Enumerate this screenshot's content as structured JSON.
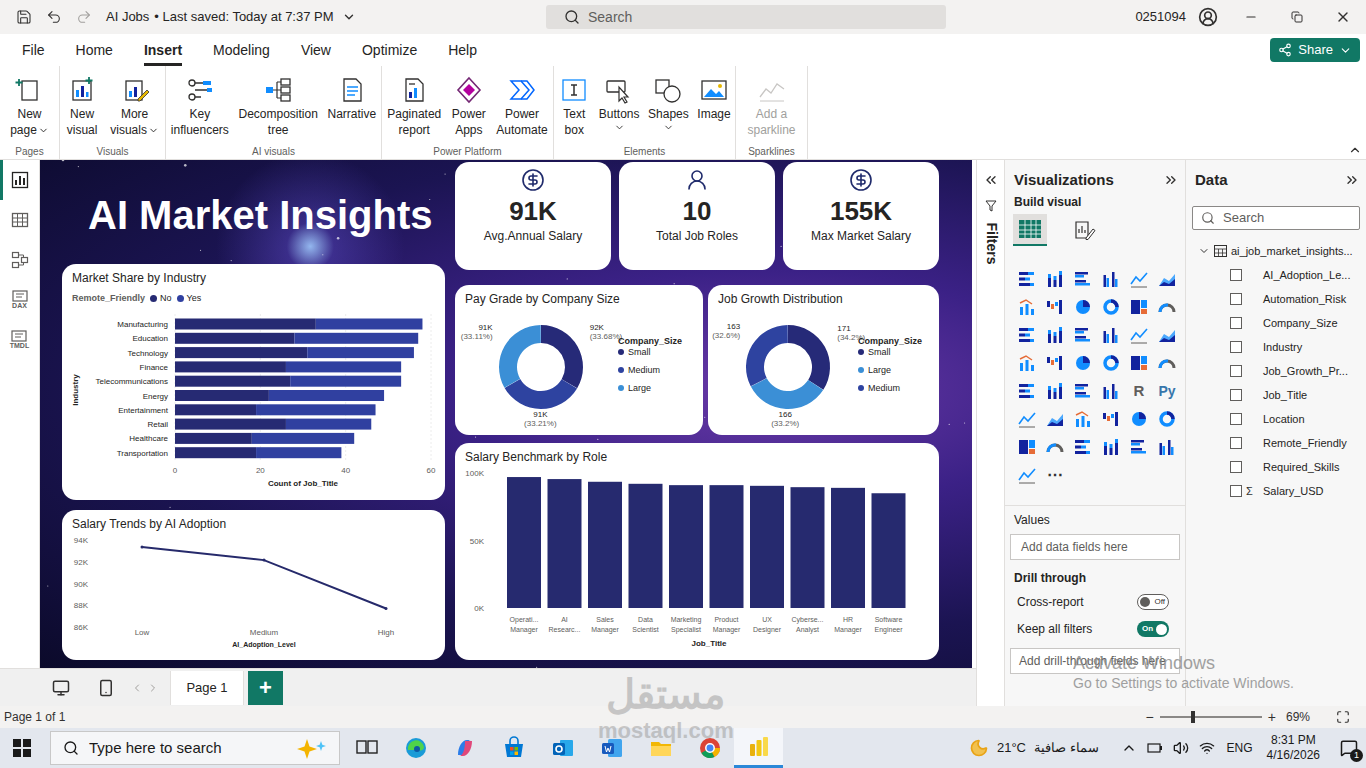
{
  "window": {
    "title": "AI Jobs",
    "saved": "• Last saved: Today at 7:37 PM",
    "search_placeholder": "Search",
    "user": "0251094"
  },
  "menu": [
    {
      "label": "File",
      "selected": false
    },
    {
      "label": "Home",
      "selected": false
    },
    {
      "label": "Insert",
      "selected": true
    },
    {
      "label": "Modeling",
      "selected": false
    },
    {
      "label": "View",
      "selected": false
    },
    {
      "label": "Optimize",
      "selected": false
    },
    {
      "label": "Help",
      "selected": false
    }
  ],
  "share": "Share",
  "ribbon": [
    {
      "group": "Pages",
      "items": [
        {
          "lines": [
            "New",
            "page"
          ],
          "dropdown": true,
          "disabled": false
        }
      ]
    },
    {
      "group": "Visuals",
      "items": [
        {
          "lines": [
            "New",
            "visual"
          ],
          "dropdown": false,
          "disabled": false
        },
        {
          "lines": [
            "More",
            "visuals"
          ],
          "dropdown": true,
          "disabled": false
        }
      ]
    },
    {
      "group": "AI visuals",
      "items": [
        {
          "lines": [
            "Key",
            "influencers"
          ],
          "dropdown": false,
          "disabled": false
        },
        {
          "lines": [
            "Decomposition",
            "tree"
          ],
          "dropdown": false,
          "disabled": false
        },
        {
          "lines": [
            "Narrative"
          ],
          "dropdown": false,
          "disabled": false
        }
      ]
    },
    {
      "group": "Power Platform",
      "items": [
        {
          "lines": [
            "Paginated",
            "report"
          ],
          "dropdown": false,
          "disabled": false
        },
        {
          "lines": [
            "Power",
            "Apps"
          ],
          "dropdown": false,
          "disabled": false
        },
        {
          "lines": [
            "Power",
            "Automate"
          ],
          "dropdown": false,
          "disabled": false
        }
      ]
    },
    {
      "group": "Elements",
      "items": [
        {
          "lines": [
            "Text",
            "box"
          ],
          "dropdown": false,
          "disabled": false
        },
        {
          "lines": [
            "Buttons"
          ],
          "dropdown": true,
          "disabled": false
        },
        {
          "lines": [
            "Shapes"
          ],
          "dropdown": true,
          "disabled": false
        },
        {
          "lines": [
            "Image"
          ],
          "dropdown": false,
          "disabled": false
        }
      ]
    },
    {
      "group": "Sparklines",
      "items": [
        {
          "lines": [
            "Add a",
            "sparkline"
          ],
          "dropdown": false,
          "disabled": true
        }
      ]
    }
  ],
  "rail": [
    {
      "kind": "report",
      "label": "",
      "selected": true
    },
    {
      "kind": "table",
      "label": "",
      "selected": false
    },
    {
      "kind": "model",
      "label": "",
      "selected": false
    },
    {
      "kind": "dax",
      "label": "DAX",
      "selected": false
    },
    {
      "kind": "tmdl",
      "label": "TMDL",
      "selected": false
    }
  ],
  "canvas": {
    "title": "AI Market Insights",
    "kpis": [
      {
        "value": "91K",
        "label": "Avg.Annual Salary"
      },
      {
        "value": "10",
        "label": "Total Job Roles"
      },
      {
        "value": "155K",
        "label": "Max Market Salary"
      }
    ],
    "market_share": {
      "title": "Market Share by Industry",
      "legend_title": "Remote_Friendly",
      "axis_title": "Industry",
      "x_title": "Count of Job_Title",
      "ticks": [
        "0",
        "20",
        "40",
        "60"
      ],
      "max": 60,
      "categories": [
        "Manufacturing",
        "Education",
        "Technology",
        "Finance",
        "Telecommunications",
        "Energy",
        "Entertainment",
        "Retail",
        "Healthcare",
        "Transportation"
      ],
      "series": [
        {
          "name": "No",
          "color": "#262a73",
          "values": [
            33,
            28,
            31,
            26,
            27,
            22,
            19,
            26,
            18,
            19
          ]
        },
        {
          "name": "Yes",
          "color": "#3040a0",
          "values": [
            25,
            29,
            25,
            27,
            26,
            27,
            28,
            20,
            24,
            20
          ]
        }
      ]
    },
    "salary_trend": {
      "title": "Salary Trends by AI Adoption",
      "categories": [
        "Low",
        "Medium",
        "High"
      ],
      "values": [
        93350,
        92150,
        87700
      ],
      "ticks": [
        "94K",
        "92K",
        "90K",
        "88K",
        "86K"
      ],
      "min": 86000,
      "max": 94000,
      "x_title": "AI_Adoption_Level"
    },
    "pay_grade": {
      "title": "Pay Grade by Company Size",
      "legend_title": "Company_Size",
      "slices": [
        {
          "name": "Small",
          "value": 92,
          "label": "92K",
          "pct": "(33.68%)",
          "color": "#262a78"
        },
        {
          "name": "Medium",
          "value": 91,
          "label": "91K",
          "pct": "(33.21%)",
          "color": "#2e43a0"
        },
        {
          "name": "Large",
          "value": 91,
          "label": "91K",
          "pct": "(33.11%)",
          "color": "#3b8fd6"
        }
      ]
    },
    "job_growth": {
      "title": "Job Growth Distribution",
      "legend_title": "Company_Size",
      "slices": [
        {
          "name": "Small",
          "value": 171,
          "label": "171",
          "pct": "(34.2%)",
          "color": "#262a78"
        },
        {
          "name": "Large",
          "value": 166,
          "label": "166",
          "pct": "(33.2%)",
          "color": "#3b8fd6"
        },
        {
          "name": "Medium",
          "value": 163,
          "label": "163",
          "pct": "(32.6%)",
          "color": "#2e43a0"
        }
      ]
    },
    "benchmark": {
      "title": "Salary Benchmark by Role",
      "ticks": [
        "100K",
        "50K",
        "0K"
      ],
      "max": 100000,
      "x_title": "Job_Title",
      "bars": [
        {
          "lines": [
            "Operati...",
            "Manager"
          ],
          "value": 97000
        },
        {
          "lines": [
            "AI",
            "Researc..."
          ],
          "value": 95500
        },
        {
          "lines": [
            "Sales",
            "Manager"
          ],
          "value": 93500
        },
        {
          "lines": [
            "Data",
            "Scientist"
          ],
          "value": 92000
        },
        {
          "lines": [
            "Marketing",
            "Specialist"
          ],
          "value": 91000
        },
        {
          "lines": [
            "Product",
            "Manager"
          ],
          "value": 91000
        },
        {
          "lines": [
            "UX",
            "Designer"
          ],
          "value": 90500
        },
        {
          "lines": [
            "Cyberse...",
            "Analyst"
          ],
          "value": 89500
        },
        {
          "lines": [
            "HR",
            "Manager"
          ],
          "value": 89000
        },
        {
          "lines": [
            "Software",
            "Engineer"
          ],
          "value": 85000
        }
      ]
    }
  },
  "filters": {
    "label": "Filters"
  },
  "visualizations": {
    "title": "Visualizations",
    "build_label": "Build visual",
    "build_tabs": [
      {
        "selected": true
      },
      {
        "selected": false
      }
    ],
    "gallery": {
      "text_items": [
        "R",
        "Py"
      ],
      "more": "⋯"
    },
    "values_label": "Values",
    "values_placeholder": "Add data fields here",
    "drill_title": "Drill through",
    "toggles": [
      {
        "label": "Cross-report",
        "on": false,
        "text": "Off"
      },
      {
        "label": "Keep all filters",
        "on": true,
        "text": "On"
      }
    ],
    "drill_placeholder": "Add drill-through fields here"
  },
  "data_pane": {
    "title": "Data",
    "search_placeholder": "Search",
    "table": {
      "name": "ai_job_market_insights...",
      "expanded": true
    },
    "fields": [
      {
        "name": "AI_Adoption_Le...",
        "symbol": "",
        "checked": false
      },
      {
        "name": "Automation_Risk",
        "symbol": "",
        "checked": false
      },
      {
        "name": "Company_Size",
        "symbol": "",
        "checked": false
      },
      {
        "name": "Industry",
        "symbol": "",
        "checked": false
      },
      {
        "name": "Job_Growth_Pr...",
        "symbol": "",
        "checked": false
      },
      {
        "name": "Job_Title",
        "symbol": "",
        "checked": false
      },
      {
        "name": "Location",
        "symbol": "",
        "checked": false
      },
      {
        "name": "Remote_Friendly",
        "symbol": "",
        "checked": false
      },
      {
        "name": "Required_Skills",
        "symbol": "",
        "checked": false
      },
      {
        "name": "Salary_USD",
        "symbol": "Σ",
        "checked": false
      }
    ]
  },
  "pages": {
    "tabs": [
      {
        "label": "Page 1",
        "selected": true
      }
    ],
    "add": "+"
  },
  "status": {
    "page": "Page 1 of 1",
    "zoom_minus": "−",
    "zoom_plus": "+",
    "zoom": "69%",
    "zoom_level": 0.31
  },
  "overlays": {
    "activate_title": "Activate Windows",
    "activate_sub": "Go to Settings to activate Windows.",
    "site_name": "مستقل",
    "site_url": "mostaql.com"
  },
  "taskbar": {
    "search": "Type here to search",
    "apps": [
      {
        "selected": false
      },
      {
        "selected": false
      },
      {
        "selected": false
      },
      {
        "selected": false
      },
      {
        "selected": false
      },
      {
        "selected": false
      },
      {
        "selected": false
      },
      {
        "selected": false
      },
      {
        "selected": true
      }
    ],
    "weather_temp": "21°C",
    "weather_text": "سماء صافية",
    "lang": "ENG",
    "time": "8:31 PM",
    "date": "4/16/2026",
    "notifications": "1"
  }
}
